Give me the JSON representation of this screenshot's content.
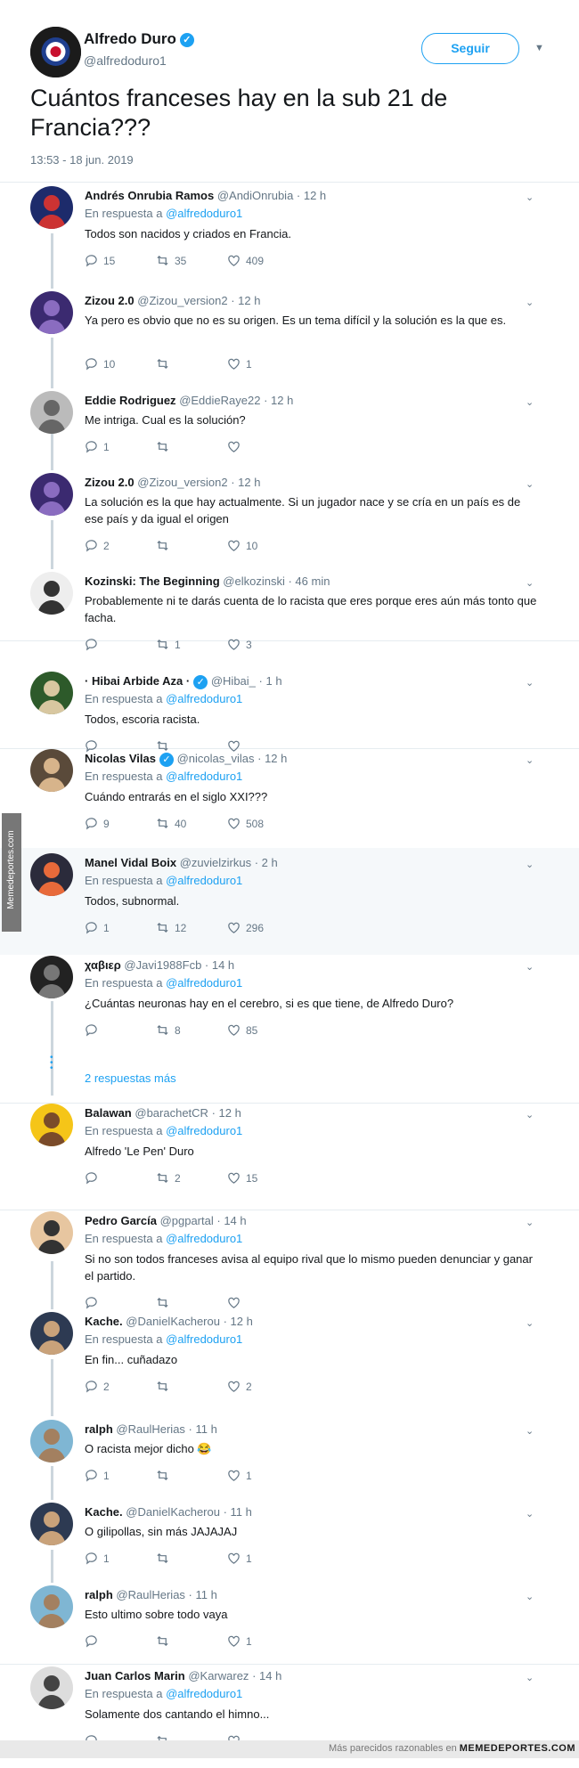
{
  "main_tweet": {
    "name": "Alfredo Duro",
    "handle": "@alfredoduro1",
    "follow_label": "Seguir",
    "text": "Cuántos franceses hay en la sub 21 de Francia???",
    "timestamp": "13:53 - 18 jun. 2019"
  },
  "reply_prefix": "En respuesta a",
  "reply_target": "@alfredoduro1",
  "tweets": [
    {
      "name": "Andrés Onrubia Ramos",
      "handle": "@AndiOnrubia",
      "time": "· 12 h",
      "text": "Todos son nacidos y criados en Francia.",
      "replies": "15",
      "retweets": "35",
      "likes": "409"
    },
    {
      "name": "Zizou 2.0",
      "handle": "@Zizou_version2",
      "time": "· 12 h",
      "text": "Ya pero es obvio que no es su origen. Es un tema difícil y la solución es la que es.",
      "replies": "10",
      "retweets": "",
      "likes": "1"
    },
    {
      "name": "Eddie Rodriguez",
      "handle": "@EddieRaye22",
      "time": "· 12 h",
      "text": "Me intriga. Cual es la solución?",
      "replies": "1",
      "retweets": "",
      "likes": ""
    },
    {
      "name": "Zizou 2.0",
      "handle": "@Zizou_version2",
      "time": "· 12 h",
      "text": "La solución es la que hay actualmente. Si un jugador nace y se cría en un país es de ese país y da igual el origen",
      "replies": "2",
      "retweets": "",
      "likes": "10"
    },
    {
      "name": "Kozinski: The Beginning",
      "handle": "@elkozinski",
      "time": "· 46 min",
      "text": "Probablemente ni te darás cuenta de lo racista que eres porque eres aún más tonto que facha.",
      "replies": "",
      "retweets": "1",
      "likes": "3"
    },
    {
      "name": "· Hibai Arbide Aza ·",
      "handle": "@Hibai_",
      "time": "· 1 h",
      "text": "Todos, escoria racista.",
      "replies": "",
      "retweets": "",
      "likes": ""
    },
    {
      "name": "Nicolas Vilas",
      "handle": "@nicolas_vilas",
      "time": "· 12 h",
      "text": "Cuándo entrarás en el siglo XXI???",
      "replies": "9",
      "retweets": "40",
      "likes": "508"
    },
    {
      "name": "Manel Vidal Boix",
      "handle": "@zuvielzirkus",
      "time": "· 2 h",
      "text": "Todos, subnormal.",
      "replies": "1",
      "retweets": "12",
      "likes": "296"
    },
    {
      "name": "χαβιερ",
      "handle": "@Javi1988Fcb",
      "time": "· 14 h",
      "text": "¿Cuántas neuronas hay en el cerebro, si es que tiene, de Alfredo Duro?",
      "replies": "",
      "retweets": "8",
      "likes": "85"
    },
    {
      "name": "Balawan",
      "handle": "@barachetCR",
      "time": "· 12 h",
      "text": "Alfredo 'Le Pen' Duro",
      "replies": "",
      "retweets": "2",
      "likes": "15"
    },
    {
      "name": "Pedro García",
      "handle": "@pgpartal",
      "time": "· 14 h",
      "text": "Si no son todos franceses avisa al equipo rival que lo mismo pueden denunciar y ganar el partido.",
      "replies": "",
      "retweets": "",
      "likes": ""
    },
    {
      "name": "Kache.",
      "handle": "@DanielKacherou",
      "time": "· 12 h",
      "text": "En fin... cuñadazo",
      "replies": "2",
      "retweets": "",
      "likes": "2"
    },
    {
      "name": "ralph",
      "handle": "@RaulHerias",
      "time": "· 11 h",
      "text": "O racista mejor dicho 😂",
      "replies": "1",
      "retweets": "",
      "likes": "1"
    },
    {
      "name": "Kache.",
      "handle": "@DanielKacherou",
      "time": "· 11 h",
      "text": "O gilipollas, sin más  JAJAJAJ",
      "replies": "1",
      "retweets": "",
      "likes": "1"
    },
    {
      "name": "ralph",
      "handle": "@RaulHerias",
      "time": "· 11 h",
      "text": "Esto ultimo sobre todo vaya",
      "replies": "",
      "retweets": "",
      "likes": "1"
    },
    {
      "name": "Juan Carlos Marin",
      "handle": "@Karwarez",
      "time": "· 14 h",
      "text": "Solamente dos cantando el himno...",
      "replies": "",
      "retweets": "",
      "likes": ""
    }
  ],
  "more_replies": "2 respuestas más",
  "watermark": {
    "side": "Memedeportes.com",
    "footer_prefix": "Más parecidos razonables en",
    "footer_brand": "MEMEDEPORTES.COM"
  },
  "colors": {
    "accent": "#1da1f2",
    "muted": "#657786",
    "line": "#ccd6dd",
    "highlight": "#f5f8fa"
  }
}
